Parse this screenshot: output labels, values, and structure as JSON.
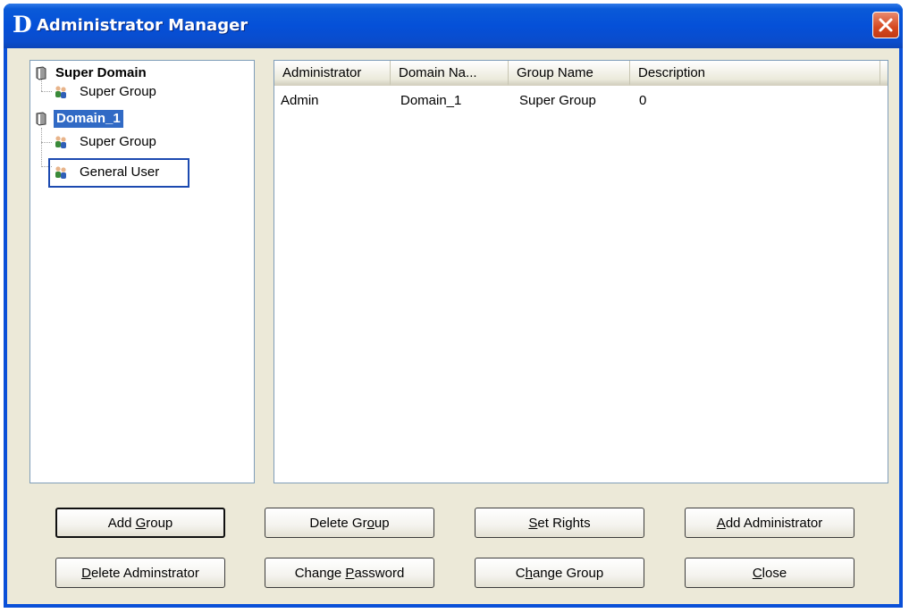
{
  "window": {
    "title": "Administrator Manager",
    "logo_text": "D"
  },
  "tree": [
    {
      "label": "Super Domain",
      "type": "domain",
      "bold": true
    },
    {
      "label": "Super Group",
      "type": "group"
    },
    {
      "label": "Domain_1",
      "type": "domain",
      "bold": true,
      "selected": true
    },
    {
      "label": "Super Group",
      "type": "group"
    },
    {
      "label": "General User",
      "type": "group",
      "focused": true
    }
  ],
  "table": {
    "columns": [
      "Administrator",
      "Domain Na...",
      "Group Name",
      "Description"
    ],
    "rows": [
      [
        "Admin",
        "Domain_1",
        "Super Group",
        "0"
      ]
    ]
  },
  "buttons": [
    {
      "label": "Add Group",
      "mnemonic": "G",
      "default": true
    },
    {
      "label": "Delete Group",
      "mnemonic": "o"
    },
    {
      "label": "Set Rights",
      "mnemonic": "S"
    },
    {
      "label": "Add Administrator",
      "mnemonic": "A"
    },
    {
      "label": "Delete Adminstrator",
      "mnemonic": "D"
    },
    {
      "label": "Change Password",
      "mnemonic": "P"
    },
    {
      "label": "Change Group",
      "mnemonic": "h"
    },
    {
      "label": "Close",
      "mnemonic": "C"
    }
  ],
  "colors": {
    "titlebar": "#0550d8",
    "client_bg": "#ece9d8",
    "selection": "#316ac5",
    "close_button": "#d54820"
  },
  "icons": {
    "domain": "domain-icon",
    "group": "user-group-icon",
    "close": "close-icon"
  }
}
